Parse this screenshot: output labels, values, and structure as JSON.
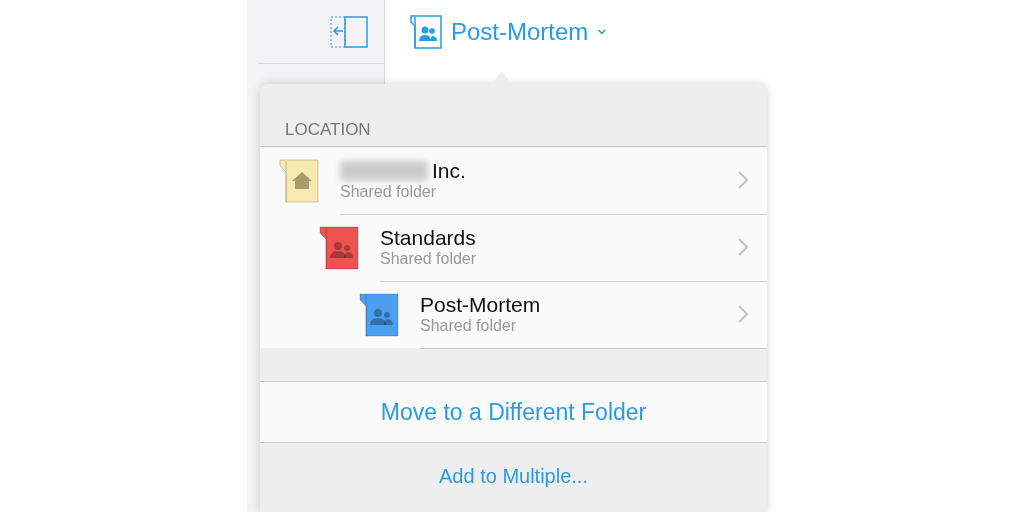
{
  "header": {
    "title": "Post-Mortem",
    "menu_caret": "⌄"
  },
  "popover": {
    "section_label": "LOCATION",
    "path": [
      {
        "name": "Inc.",
        "name_redacted": true,
        "subtitle": "Shared folder",
        "kind": "home",
        "color": "#f7eab0",
        "children": [
          {
            "name": "Standards",
            "subtitle": "Shared folder",
            "kind": "shared",
            "color": "#ef5350",
            "children": [
              {
                "name": "Post-Mortem",
                "subtitle": "Shared folder",
                "kind": "shared",
                "color": "#4c9ff0"
              }
            ]
          }
        ]
      }
    ],
    "actions": [
      {
        "label": "Move to a Different Folder",
        "kind": "primary"
      },
      {
        "label": "Add to Multiple...",
        "kind": "secondary"
      }
    ]
  }
}
